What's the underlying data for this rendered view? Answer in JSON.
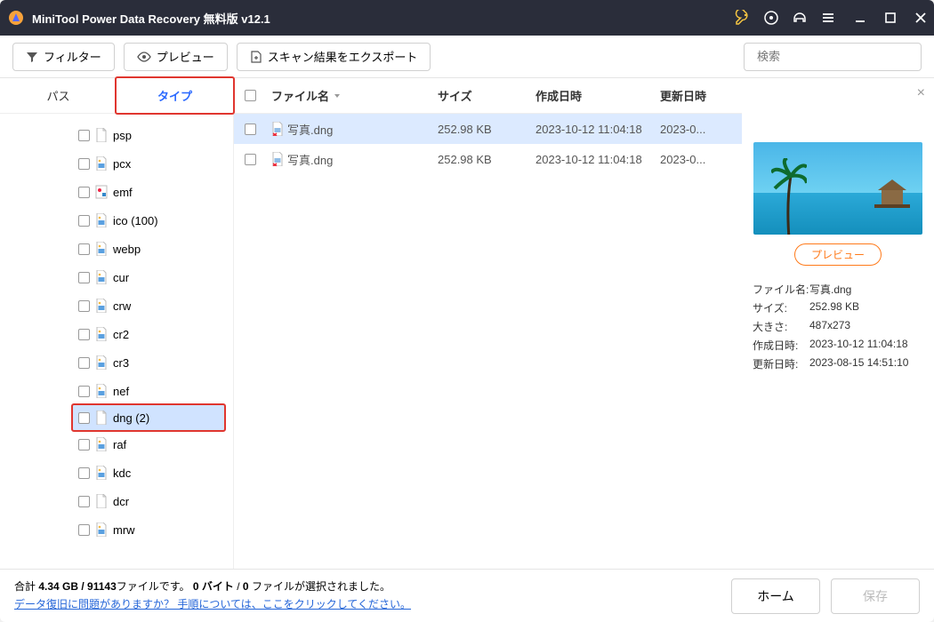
{
  "titlebar": {
    "title": "MiniTool Power Data Recovery 無料版 v12.1"
  },
  "toolbar": {
    "filter": "フィルター",
    "preview": "プレビュー",
    "export": "スキャン結果をエクスポート",
    "search_placeholder": "検索"
  },
  "tabs": {
    "path": "パス",
    "type": "タイプ"
  },
  "tree_items": [
    {
      "label": "psp",
      "icon": "blank"
    },
    {
      "label": "pcx",
      "icon": "img"
    },
    {
      "label": "emf",
      "icon": "emf"
    },
    {
      "label": "ico (100)",
      "icon": "img"
    },
    {
      "label": "webp",
      "icon": "img"
    },
    {
      "label": "cur",
      "icon": "img"
    },
    {
      "label": "crw",
      "icon": "img"
    },
    {
      "label": "cr2",
      "icon": "img"
    },
    {
      "label": "cr3",
      "icon": "img"
    },
    {
      "label": "nef",
      "icon": "img"
    },
    {
      "label": "dng (2)",
      "icon": "blank",
      "selected": true
    },
    {
      "label": "raf",
      "icon": "img"
    },
    {
      "label": "kdc",
      "icon": "img"
    },
    {
      "label": "dcr",
      "icon": "blank"
    },
    {
      "label": "mrw",
      "icon": "img"
    }
  ],
  "columns": {
    "name": "ファイル名",
    "size": "サイズ",
    "created": "作成日時",
    "modified": "更新日時"
  },
  "files": [
    {
      "name": "写真.dng",
      "size": "252.98 KB",
      "created": "2023-10-12 11:04:18",
      "modified": "2023-0...",
      "selected": true
    },
    {
      "name": "写真.dng",
      "size": "252.98 KB",
      "created": "2023-10-12 11:04:18",
      "modified": "2023-0...",
      "selected": false
    }
  ],
  "preview": {
    "button": "プレビュー",
    "labels": {
      "filename": "ファイル名:",
      "size": "サイズ:",
      "dims": "大きさ:",
      "created": "作成日時:",
      "modified": "更新日時:"
    },
    "values": {
      "filename": "写真.dng",
      "size": "252.98 KB",
      "dims": "487x273",
      "created": "2023-10-12 11:04:18",
      "modified": "2023-08-15 14:51:10"
    }
  },
  "status": {
    "summary_pre": "合計 ",
    "summary_total": "4.34 GB / 91143",
    "summary_mid1": "ファイルです。 ",
    "summary_bytes": "0 バイト",
    "summary_sep": " / ",
    "summary_sel": "0",
    "summary_post": " ファイルが選択されました。",
    "help_link": "データ復旧に問題がありますか？ 手順については、ここをクリックしてください。",
    "home": "ホーム",
    "save": "保存"
  }
}
